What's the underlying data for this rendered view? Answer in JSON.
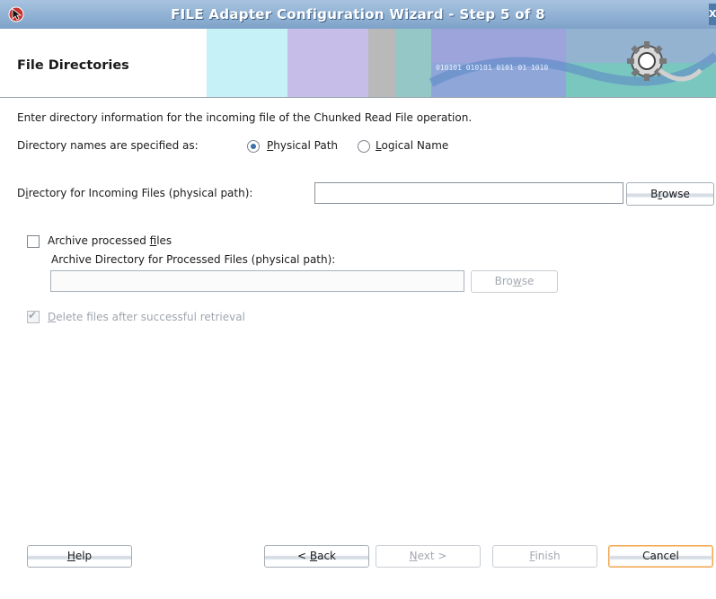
{
  "window": {
    "title": "FILE Adapter Configuration Wizard - Step 5 of 8",
    "close_glyph": "X"
  },
  "header": {
    "title": "File Directories",
    "banner_text": "010101 010101 0101 01 1010"
  },
  "instructions": "Enter directory information for the incoming file of the Chunked Read File operation.",
  "directory_names": {
    "label": "Directory names are specified as:",
    "options": [
      {
        "label": "Physical Path",
        "mnemonic": "P",
        "rest": "hysical Path",
        "selected": true
      },
      {
        "label": "Logical Name",
        "mnemonic": "L",
        "rest": "ogical Name",
        "selected": false
      }
    ]
  },
  "incoming": {
    "label_pre": "D",
    "label_mnemonic": "i",
    "label_post": "rectory for Incoming Files (physical path):",
    "value": "",
    "browse": {
      "pre": "B",
      "mnemonic": "r",
      "post": "owse"
    }
  },
  "archive": {
    "checkbox_pre": "Archive processed ",
    "checkbox_mnemonic": "f",
    "checkbox_post": "iles",
    "checked": false,
    "dir_label": "Archive Directory for Processed Files (physical path):",
    "value": "",
    "browse": {
      "pre": "Bro",
      "mnemonic": "w",
      "post": "se"
    }
  },
  "delete": {
    "mnemonic": "D",
    "rest": "elete files after successful retrieval",
    "checked": true,
    "enabled": false
  },
  "buttons": {
    "help": {
      "mnemonic": "H",
      "rest": "elp"
    },
    "back": {
      "pre": "< ",
      "mnemonic": "B",
      "rest": "ack"
    },
    "next": {
      "mnemonic": "N",
      "rest": "ext >"
    },
    "finish": {
      "mnemonic": "F",
      "rest": "inish"
    },
    "cancel": {
      "label": "Cancel"
    }
  },
  "colors": {
    "titlebar": "#8fb0d4",
    "banner_stripes": [
      "#c6f2f7",
      "#c7bde9",
      "#b9b9b9",
      "#96c7c7",
      "#7f9fd4",
      "#7ac7bf"
    ],
    "default_button_border": "#f1a44d",
    "radio_selected": "#3d6fa8"
  }
}
